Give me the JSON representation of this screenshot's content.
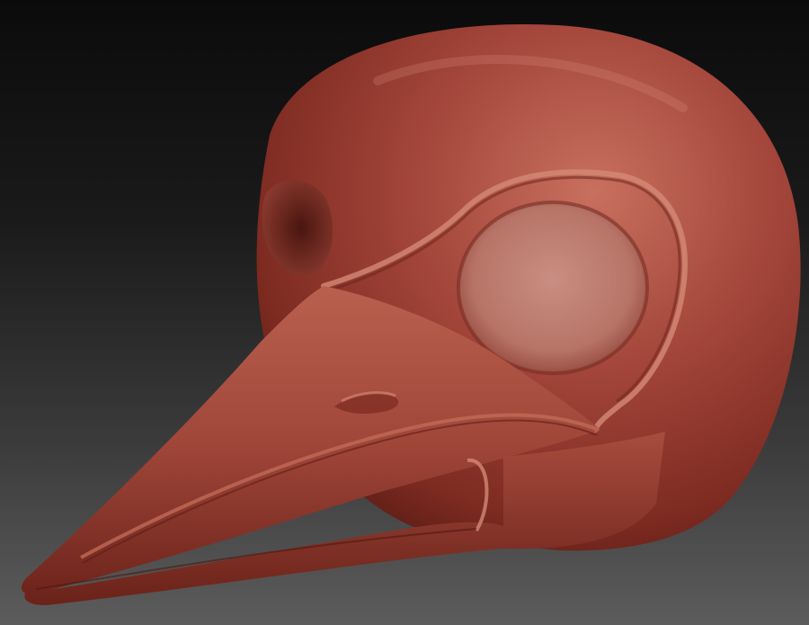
{
  "scene": {
    "subject": "",
    "background_colors": [
      "#0b0b0b",
      "#5c5c5c"
    ],
    "material_colors": {
      "base": "#9a3a2c",
      "highlight": "#c9705e",
      "shadow": "#5a1c14"
    }
  }
}
